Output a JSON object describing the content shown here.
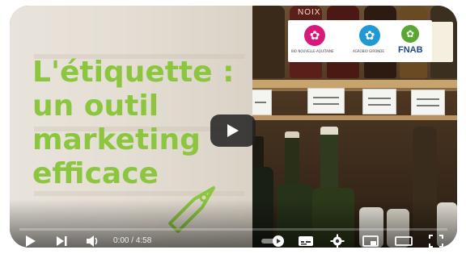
{
  "video": {
    "title_lines": [
      "L'étiquette :",
      "un outil",
      "marketing",
      "efficace"
    ],
    "bottle_label_text": "NOIX",
    "logos": {
      "logo1_caption": "BIO NOUVELLE-AQUITAINE",
      "logo2_caption": "AGROBIO GIRONDE",
      "logo3_name": "FNAB"
    }
  },
  "player": {
    "current_time": "0:00",
    "separator": " / ",
    "duration": "4:58",
    "progress": 0.0,
    "icons": {
      "play": "play-icon",
      "next": "next-icon",
      "volume": "volume-icon",
      "autoplay": "autoplay-toggle-icon",
      "subtitles": "subtitles-icon",
      "settings": "gear-icon",
      "miniplayer": "miniplayer-icon",
      "theater": "theater-mode-icon",
      "fullscreen": "fullscreen-icon"
    },
    "accent_color": "#ff0000",
    "title_color": "#8cc63f"
  }
}
